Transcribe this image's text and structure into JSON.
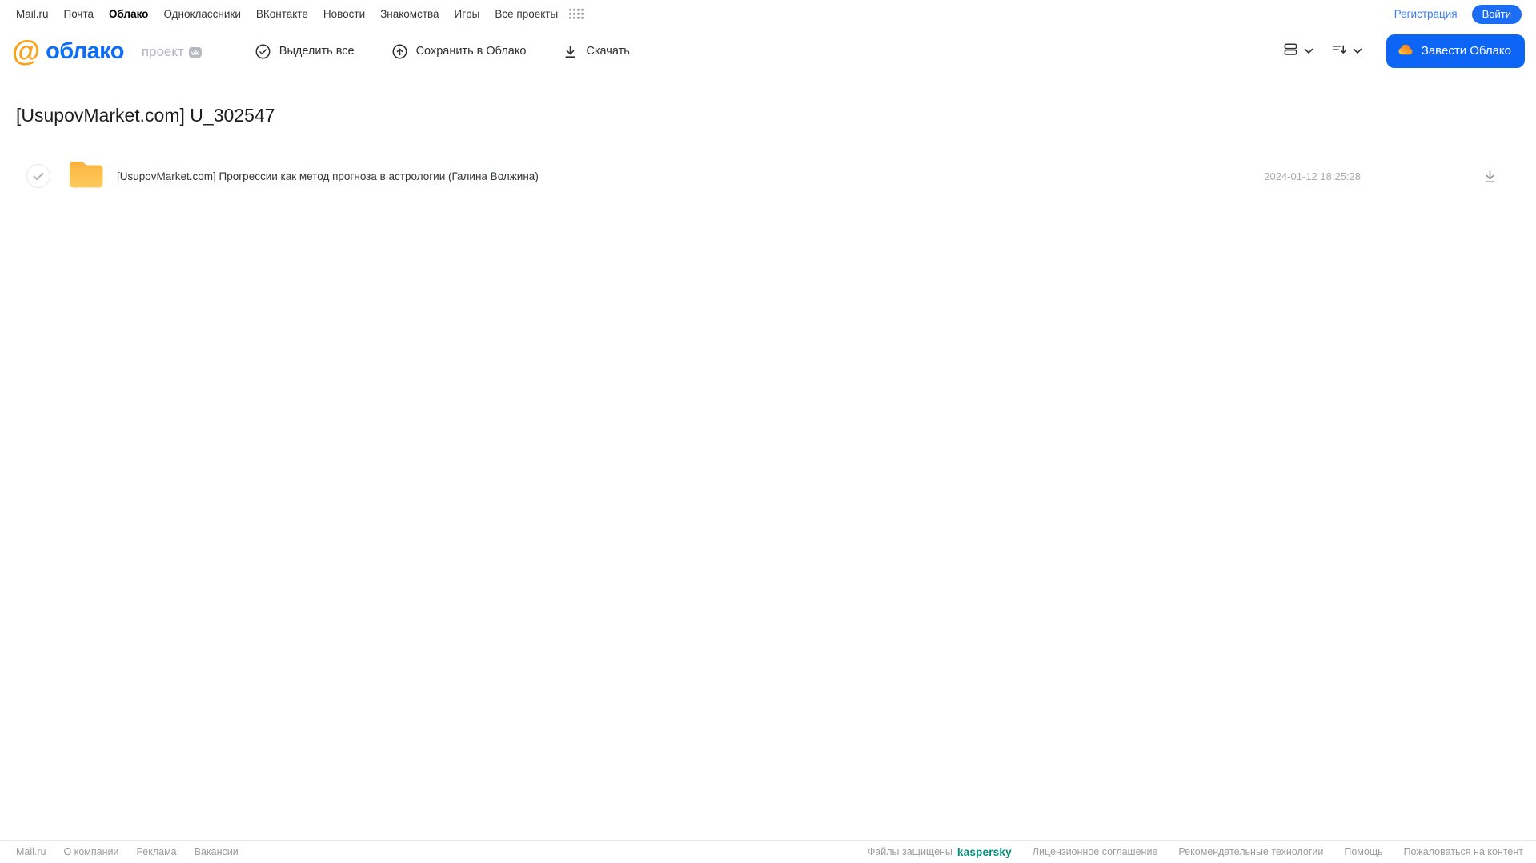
{
  "topnav": {
    "items": [
      {
        "label": "Mail.ru"
      },
      {
        "label": "Почта"
      },
      {
        "label": "Облако"
      },
      {
        "label": "Одноклассники"
      },
      {
        "label": "ВКонтакте"
      },
      {
        "label": "Новости"
      },
      {
        "label": "Знакомства"
      },
      {
        "label": "Игры"
      },
      {
        "label": "Все проекты"
      }
    ],
    "registration_label": "Регистрация",
    "login_label": "Войти"
  },
  "header": {
    "logo_at": "@",
    "logo_text": "облако",
    "project_label": "проект",
    "vk_badge_label": "vk",
    "toolbar": {
      "select_all": "Выделить все",
      "save_to_cloud": "Сохранить в Облако",
      "download": "Скачать"
    },
    "get_cloud_label": "Завести Облако"
  },
  "main": {
    "title": "[UsupovMarket.com] U_302547",
    "files": [
      {
        "type": "folder",
        "name": "[UsupovMarket.com] Прогрессии как метод прогноза в астрологии (Галина Волжина)",
        "date": "2024-01-12 18:25:28"
      }
    ]
  },
  "footer": {
    "links_left": [
      "Mail.ru",
      "О компании",
      "Реклама",
      "Вакансии"
    ],
    "protected_by": "Файлы защищены",
    "kaspersky_label": "kaspersky",
    "links_right": [
      "Лицензионное соглашение",
      "Рекомендательные технологии",
      "Помощь",
      "Пожаловаться на контент"
    ]
  },
  "colors": {
    "accent_blue": "#0D65F6",
    "link_blue": "#3D7DF7",
    "logo_orange": "#F9A11B",
    "folder_yellow": "#FBBC4A",
    "kaspersky_green": "#008E76",
    "text_dark": "#2E2F31",
    "text_gray": "#9C9C9C"
  }
}
